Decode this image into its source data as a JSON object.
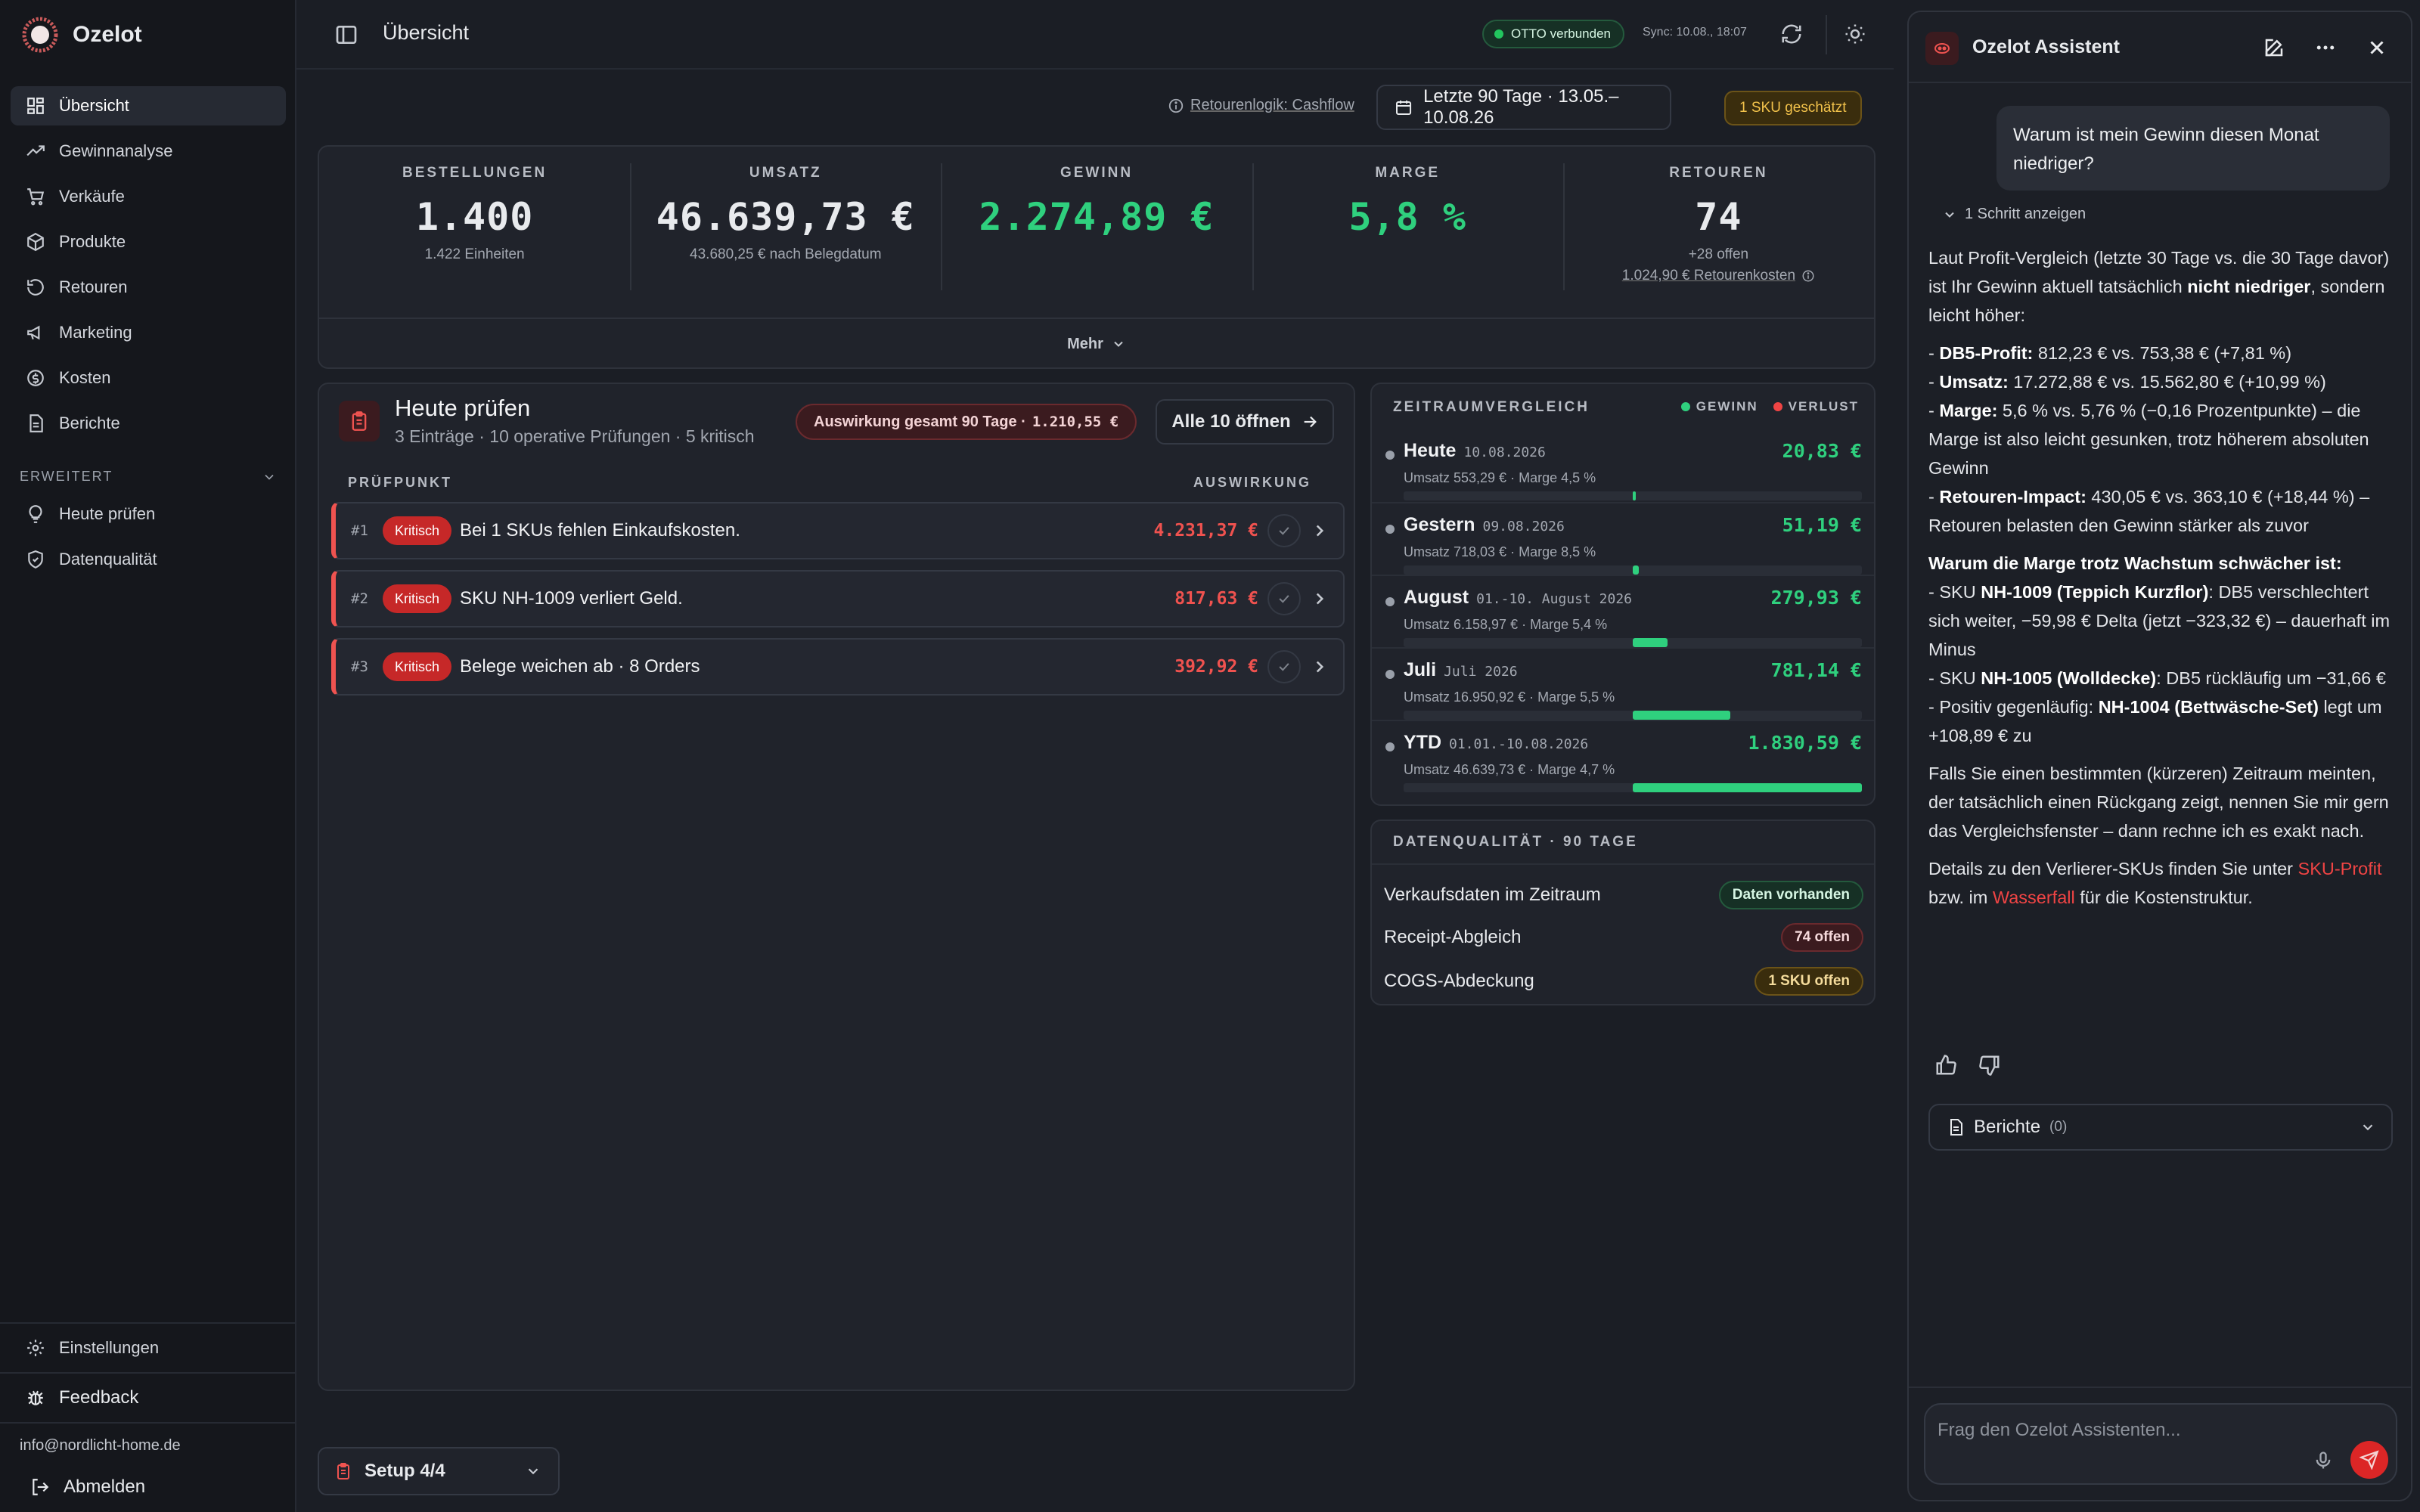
{
  "app": {
    "name": "Ozelot"
  },
  "sidebar": {
    "items": [
      {
        "label": "Übersicht",
        "icon": "dashboard-icon"
      },
      {
        "label": "Gewinnanalyse",
        "icon": "trending-up-icon"
      },
      {
        "label": "Verkäufe",
        "icon": "cart-icon"
      },
      {
        "label": "Produkte",
        "icon": "box-icon"
      },
      {
        "label": "Retouren",
        "icon": "return-icon"
      },
      {
        "label": "Marketing",
        "icon": "megaphone-icon"
      },
      {
        "label": "Kosten",
        "icon": "coin-icon"
      },
      {
        "label": "Berichte",
        "icon": "document-icon"
      }
    ],
    "section_title": "ERWEITERT",
    "extended": [
      {
        "label": "Heute prüfen",
        "icon": "lightbulb-icon"
      },
      {
        "label": "Datenqualität",
        "icon": "shield-check-icon"
      }
    ],
    "settings": "Einstellungen",
    "feedback": "Feedback",
    "email": "info@nordlicht-home.de",
    "logout": "Abmelden"
  },
  "topbar": {
    "title": "Übersicht",
    "connection": "OTTO verbunden",
    "sync": "Sync: 10.08., 18:07"
  },
  "filters": {
    "return_logic_label": "Retourenlogik: Cashflow",
    "date_range": "Letzte 90 Tage · 13.05.–10.08.26",
    "sku_badge": "1 SKU geschätzt"
  },
  "kpis": {
    "orders": {
      "label": "BESTELLUNGEN",
      "value": "1.400",
      "sub": "1.422 Einheiten"
    },
    "revenue": {
      "label": "UMSATZ",
      "value": "46.639,73 €",
      "sub": "43.680,25 € nach Belegdatum"
    },
    "profit": {
      "label": "GEWINN",
      "value": "2.274,89 €"
    },
    "margin": {
      "label": "MARGE",
      "value": "5,8 %"
    },
    "returns": {
      "label": "RETOUREN",
      "value": "74",
      "sub": "+28 offen",
      "sub2": "1.024,90 € Retourenkosten"
    },
    "more": "Mehr"
  },
  "check": {
    "title": "Heute prüfen",
    "subtitle": "3 Einträge · 10 operative Prüfungen · 5 kritisch",
    "impact_label": "Auswirkung gesamt 90 Tage ·",
    "impact_value": "1.210,55 €",
    "open_all": "Alle 10 öffnen",
    "col_check": "PRÜFPUNKT",
    "col_impact": "AUSWIRKUNG",
    "rows": [
      {
        "num": "#1",
        "badge": "Kritisch",
        "text": "Bei 1 SKUs fehlen Einkaufskosten.",
        "amount": "4.231,37 €"
      },
      {
        "num": "#2",
        "badge": "Kritisch",
        "text": "SKU NH-1009 verliert Geld.",
        "amount": "817,63 €"
      },
      {
        "num": "#3",
        "badge": "Kritisch",
        "text": "Belege weichen ab · 8 Orders",
        "amount": "392,92 €"
      }
    ]
  },
  "compare": {
    "title": "ZEITRAUMVERGLEICH",
    "legend_gain": "GEWINN",
    "legend_loss": "VERLUST",
    "color_gain": "#2fd07e",
    "color_loss": "#ef4444",
    "rows": [
      {
        "name": "Heute",
        "range": "10.08.2026",
        "meta": "Umsatz 553,29 € · Marge 4,5 %",
        "gain": "20,83 €",
        "profit": 20.83
      },
      {
        "name": "Gestern",
        "range": "09.08.2026",
        "meta": "Umsatz 718,03 € · Marge 8,5 %",
        "gain": "51,19 €",
        "profit": 51.19
      },
      {
        "name": "August",
        "range": "01.-10. August 2026",
        "meta": "Umsatz 6.158,97 € · Marge 5,4 %",
        "gain": "279,93 €",
        "profit": 279.93
      },
      {
        "name": "Juli",
        "range": "Juli 2026",
        "meta": "Umsatz 16.950,92 € · Marge 5,5 %",
        "gain": "781,14 €",
        "profit": 781.14
      },
      {
        "name": "YTD",
        "range": "01.01.-10.08.2026",
        "meta": "Umsatz 46.639,73 € · Marge 4,7 %",
        "gain": "1.830,59 €",
        "profit": 1830.59
      }
    ]
  },
  "quality": {
    "title": "DATENQUALITÄT · 90 TAGE",
    "rows": [
      {
        "label": "Verkaufsdaten im Zeitraum",
        "status": "Daten vorhanden",
        "tone": "g"
      },
      {
        "label": "Receipt-Abgleich",
        "status": "74 offen",
        "tone": "r"
      },
      {
        "label": "COGS-Abdeckung",
        "status": "1 SKU offen",
        "tone": "y"
      }
    ]
  },
  "setup": {
    "label": "Setup 4/4"
  },
  "assistant": {
    "title": "Ozelot Assistent",
    "user_message": "Warum ist mein Gewinn diesen Monat niedriger?",
    "steps": "1 Schritt anzeigen",
    "p1a": "Laut Profit-Vergleich (letzte 30 Tage vs. die 30 Tage davor) ist Ihr Gewinn aktuell tatsächlich ",
    "p1b": "nicht niedriger",
    "p1c": ", sondern leicht höher:",
    "b1k": "DB5-Profit:",
    "b1v": " 812,23 € vs. 753,38 € (+7,81 %)",
    "b2k": "Umsatz:",
    "b2v": " 17.272,88 € vs. 15.562,80 € (+10,99 %)",
    "b3k": "Marge:",
    "b3v": " 5,6 % vs. 5,76 % (−0,16 Prozentpunkte) – die Marge ist also leicht gesunken, trotz höherem absoluten Gewinn",
    "b4k": "Retouren-Impact:",
    "b4v": " 430,05 € vs. 363,10 € (+18,44 %) – Retouren belasten den Gewinn stärker als zuvor",
    "h2": "Warum die Marge trotz Wachstum schwächer ist:",
    "c1a": "- SKU ",
    "c1b": "NH-1009 (Teppich Kurzflor)",
    "c1c": ": DB5 verschlechtert sich weiter, −59,98 € Delta (jetzt −323,32 €) – dauerhaft im Minus",
    "c2a": "- SKU ",
    "c2b": "NH-1005 (Wolldecke)",
    "c2c": ": DB5 rückläufig um −31,66 €",
    "c3a": "- Positiv gegenläufig: ",
    "c3b": "NH-1004 (Bettwäsche-Set)",
    "c3c": " legt um +108,89 € zu",
    "p3": "Falls Sie einen bestimmten (kürzeren) Zeitraum meinten, der tatsächlich einen Rückgang zeigt, nennen Sie mir gern das Vergleichsfenster – dann rechne ich es exakt nach.",
    "p4a": "Details zu den Verlierer-SKUs finden Sie unter ",
    "p4link1": "SKU-Profit",
    "p4b": " bzw. im ",
    "p4link2": "Wasserfall",
    "p4c": " für die Kostenstruktur.",
    "reports_label": "Berichte",
    "reports_count": "(0)",
    "input_placeholder": "Frag den Ozelot Assistenten..."
  }
}
